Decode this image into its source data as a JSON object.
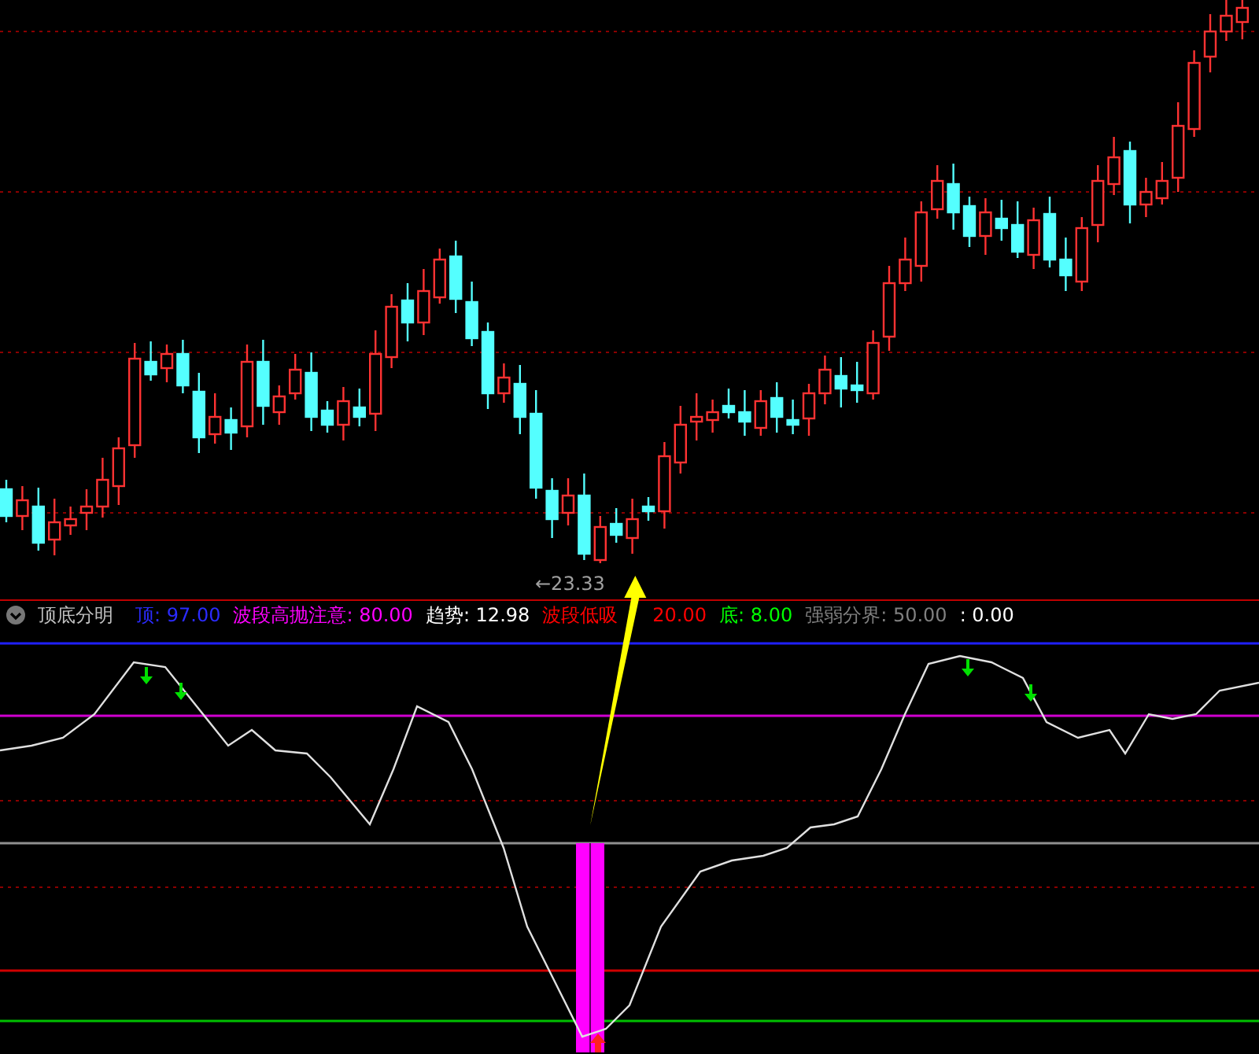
{
  "price_chart": {
    "low_price_label": "←23.33"
  },
  "indicator": {
    "name": "顶底分明",
    "legend": [
      {
        "text": "顶: 97.00",
        "color": "#2b2bff"
      },
      {
        "text": "波段高抛注意: 80.00",
        "color": "#ff00ff"
      },
      {
        "text": "趋势: 12.98",
        "color": "#ffffff"
      },
      {
        "text": "波段低吸",
        "color": "#ff0000"
      },
      {
        "text": "20.00",
        "color": "#ff0000"
      },
      {
        "text": "底: 8.00",
        "color": "#00ff00"
      },
      {
        "text": "强弱分界: 50.00",
        "color": "#808080"
      },
      {
        "text": ": 0.00",
        "color": "#ffffff"
      }
    ]
  }
}
